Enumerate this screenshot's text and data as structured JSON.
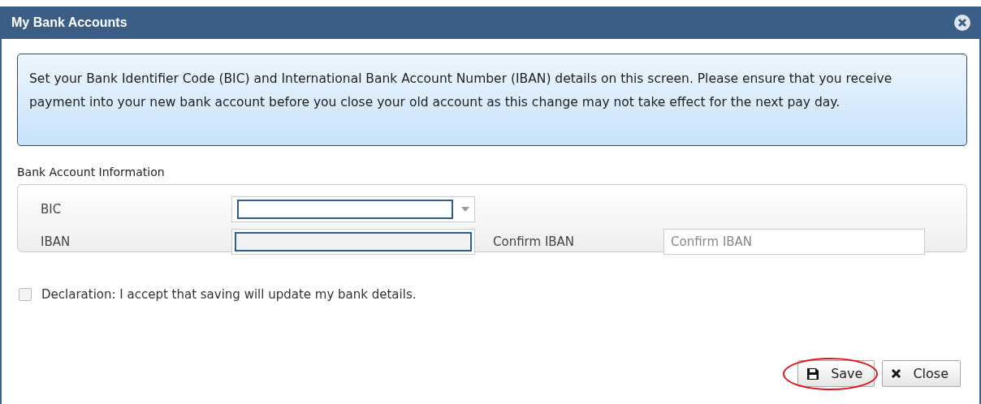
{
  "window": {
    "title": "My Bank Accounts"
  },
  "notice": "Set your Bank Identifier Code (BIC) and International Bank Account Number (IBAN) details on this screen. Please ensure that you receive payment into your new bank account before you close your old account as this change may not take effect for the next pay day.",
  "section": {
    "title": "Bank Account Information"
  },
  "fields": [
    {
      "kind": "dropdown",
      "label": "BIC",
      "focused": true
    },
    {
      "kind": "text",
      "label": "IBAN",
      "focused": true,
      "confirm_label": "Confirm IBAN",
      "confirm_placeholder": "Confirm IBAN"
    }
  ],
  "declaration": {
    "label": "Declaration: I accept that saving will update my bank details.",
    "checked": false
  },
  "buttons": [
    {
      "kind": "save",
      "label": "Save",
      "circled": true
    },
    {
      "kind": "close",
      "label": "Close",
      "circled": false
    }
  ]
}
